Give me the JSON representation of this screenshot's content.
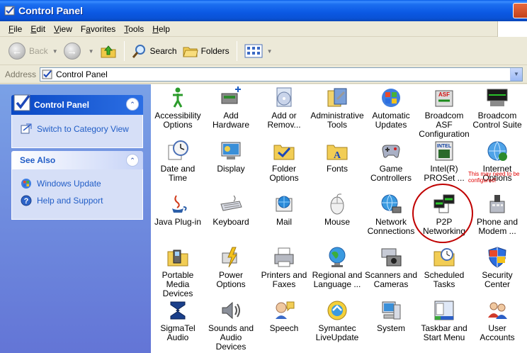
{
  "window": {
    "title": "Control Panel"
  },
  "menu": [
    {
      "pre": "",
      "ul": "F",
      "post": "ile"
    },
    {
      "pre": "",
      "ul": "E",
      "post": "dit"
    },
    {
      "pre": "",
      "ul": "V",
      "post": "iew"
    },
    {
      "pre": "F",
      "ul": "a",
      "post": "vorites"
    },
    {
      "pre": "",
      "ul": "T",
      "post": "ools"
    },
    {
      "pre": "",
      "ul": "H",
      "post": "elp"
    }
  ],
  "toolbar": {
    "back": "Back",
    "search": "Search",
    "folders": "Folders"
  },
  "address": {
    "label": "Address",
    "value": "Control Panel"
  },
  "taskpane": {
    "control_panel": {
      "title": "Control Panel",
      "switch_link": "Switch to Category View"
    },
    "see_also": {
      "title": "See Also",
      "links": [
        "Windows Update",
        "Help and Support"
      ]
    }
  },
  "items": [
    {
      "label": "Accessibility\nOptions",
      "icon": "accessibility-icon"
    },
    {
      "label": "Add Hardware",
      "icon": "add-hardware-icon"
    },
    {
      "label": "Add or\nRemov...",
      "icon": "add-remove-programs-icon"
    },
    {
      "label": "Administrative\nTools",
      "icon": "administrative-tools-icon"
    },
    {
      "label": "Automatic\nUpdates",
      "icon": "automatic-updates-icon"
    },
    {
      "label": "Broadcom ASF\nConfiguration",
      "icon": "broadcom-asf-icon"
    },
    {
      "label": "Broadcom\nControl Suite",
      "icon": "broadcom-control-suite-icon"
    },
    {
      "label": "Date and Time",
      "icon": "date-time-icon"
    },
    {
      "label": "Display",
      "icon": "display-icon"
    },
    {
      "label": "Folder Options",
      "icon": "folder-options-icon"
    },
    {
      "label": "Fonts",
      "icon": "fonts-icon"
    },
    {
      "label": "Game\nControllers",
      "icon": "game-controllers-icon"
    },
    {
      "label": "Intel(R)\nPROSet ...",
      "icon": "intel-proset-icon"
    },
    {
      "label": "Internet\nOptions",
      "icon": "internet-options-icon"
    },
    {
      "label": "Java Plug-in",
      "icon": "java-icon"
    },
    {
      "label": "Keyboard",
      "icon": "keyboard-icon"
    },
    {
      "label": "Mail",
      "icon": "mail-icon"
    },
    {
      "label": "Mouse",
      "icon": "mouse-icon"
    },
    {
      "label": "Network\nConnections",
      "icon": "network-connections-icon"
    },
    {
      "label": "P2P\nNetworking",
      "icon": "p2p-networking-icon"
    },
    {
      "label": "Phone and\nModem ...",
      "icon": "phone-modem-icon"
    },
    {
      "label": "Portable Media\nDevices",
      "icon": "portable-media-icon"
    },
    {
      "label": "Power Options",
      "icon": "power-options-icon"
    },
    {
      "label": "Printers and\nFaxes",
      "icon": "printers-faxes-icon"
    },
    {
      "label": "Regional and\nLanguage ...",
      "icon": "regional-language-icon"
    },
    {
      "label": "Scanners and\nCameras",
      "icon": "scanners-cameras-icon"
    },
    {
      "label": "Scheduled\nTasks",
      "icon": "scheduled-tasks-icon"
    },
    {
      "label": "Security\nCenter",
      "icon": "security-center-icon"
    },
    {
      "label": "SigmaTel\nAudio",
      "icon": "sigmatel-audio-icon"
    },
    {
      "label": "Sounds and\nAudio Devices",
      "icon": "sounds-audio-icon"
    },
    {
      "label": "Speech",
      "icon": "speech-icon"
    },
    {
      "label": "Symantec\nLiveUpdate",
      "icon": "symantec-liveupdate-icon"
    },
    {
      "label": "System",
      "icon": "system-icon"
    },
    {
      "label": "Taskbar and\nStart Menu",
      "icon": "taskbar-start-menu-icon"
    },
    {
      "label": "User Accounts",
      "icon": "user-accounts-icon"
    }
  ],
  "annotation": "This may need to be\nconfigured!"
}
